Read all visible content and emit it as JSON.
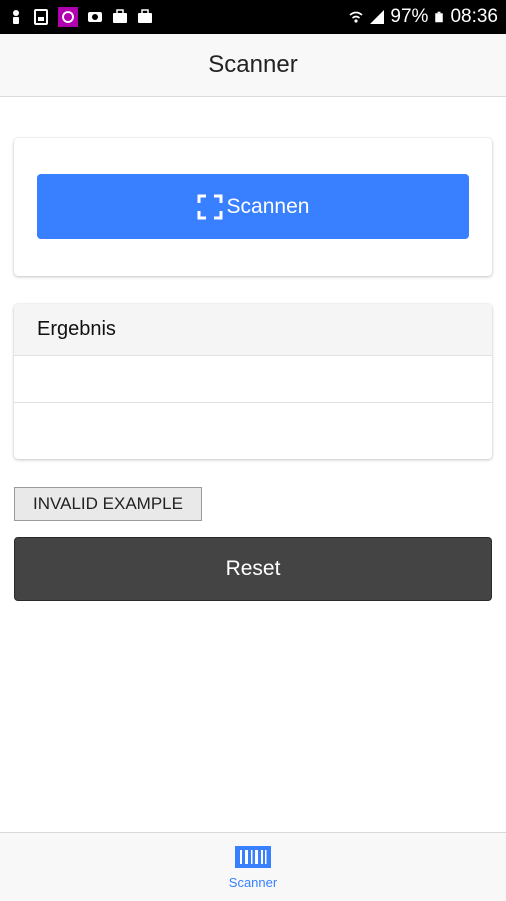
{
  "status_bar": {
    "battery": "97%",
    "time": "08:36",
    "icons": [
      "person-icon",
      "sim-icon",
      "app-badge-icon",
      "eye-icon",
      "briefcase-icon",
      "briefcase-icon",
      "wifi-icon",
      "signal-icon",
      "battery-icon"
    ]
  },
  "header": {
    "title": "Scanner"
  },
  "scan_card": {
    "button_label": "Scannen",
    "button_icon": "scan-frame-icon"
  },
  "result_card": {
    "title": "Ergebnis"
  },
  "actions": {
    "invalid_label": "INVALID EXAMPLE",
    "reset_label": "Reset"
  },
  "tabbar": {
    "tabs": [
      {
        "label": "Scanner",
        "icon": "barcode-icon"
      }
    ]
  },
  "colors": {
    "accent": "#3880ff",
    "reset_bg": "#444444",
    "status_bar": "#000000"
  }
}
